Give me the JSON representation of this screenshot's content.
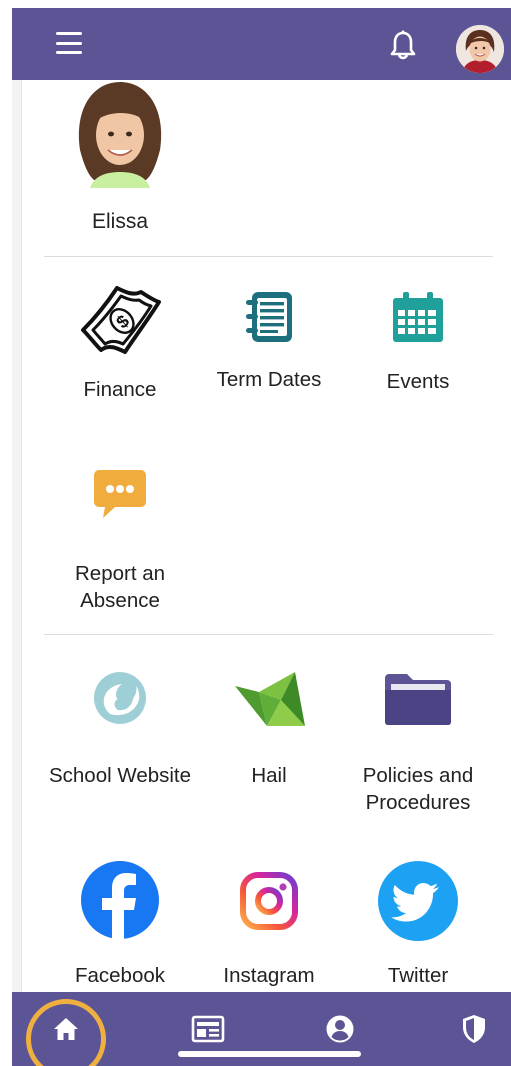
{
  "header": {
    "menu_icon": "hamburger-menu-icon",
    "notification_icon": "bell-icon",
    "avatar_icon": "profile-avatar"
  },
  "child": {
    "name": "Elissa"
  },
  "sections": {
    "school": [
      {
        "label": "Finance",
        "icon": "money-bill-icon"
      },
      {
        "label": "Term Dates",
        "icon": "notebook-icon"
      },
      {
        "label": "Events",
        "icon": "calendar-icon"
      },
      {
        "label": "Report an Absence",
        "icon": "chat-bubble-icon"
      }
    ],
    "links": [
      {
        "label": "School Website",
        "icon": "school-logo-icon"
      },
      {
        "label": "Hail",
        "icon": "hail-bird-icon"
      },
      {
        "label": "Policies and Procedures",
        "icon": "folder-icon"
      },
      {
        "label": "Facebook",
        "icon": "facebook-icon"
      },
      {
        "label": "Instagram",
        "icon": "instagram-icon"
      },
      {
        "label": "Twitter",
        "icon": "twitter-icon"
      }
    ]
  },
  "bottom_nav": {
    "items": [
      "home-icon",
      "news-icon",
      "account-icon",
      "shield-icon"
    ],
    "active": "home-icon"
  },
  "colors": {
    "bar": "#5c5595",
    "teal": "#1fa09a",
    "orange": "#f0ac3c",
    "folder": "#5b5595",
    "facebook": "#1877f2",
    "twitter": "#1da1f2",
    "active_ring": "#f0b040"
  }
}
